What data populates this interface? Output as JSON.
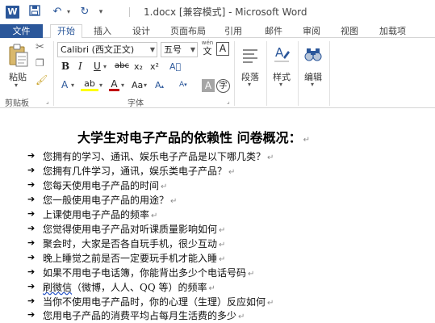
{
  "titlebar": {
    "title": "1.docx [兼容模式] - Microsoft Word",
    "app_icon_letter": "W",
    "qat": {
      "save_icon": "save-icon",
      "undo_icon": "undo-icon",
      "redo_icon": "redo-icon",
      "customize_icon": "customize-qat-icon"
    }
  },
  "tabs": {
    "file": "文件",
    "items": [
      "开始",
      "插入",
      "设计",
      "页面布局",
      "引用",
      "邮件",
      "审阅",
      "视图",
      "加载项"
    ],
    "active": "开始"
  },
  "ribbon": {
    "clipboard": {
      "paste_label": "粘贴",
      "group_label": "剪贴板"
    },
    "font": {
      "font_name": "Calibri (西文正文)",
      "font_size": "五号",
      "wen_label": "wén",
      "wen_char": "文",
      "bold": "B",
      "italic": "I",
      "underline": "U",
      "strike": "abc",
      "subscript": "x₂",
      "superscript": "x²",
      "grow_font": "A",
      "shrink_font": "A",
      "case_label": "Aa",
      "clear_format_label": "A",
      "highlight_label": "ab",
      "font_color_label": "A",
      "char_shade_label": "A",
      "enclose_char_label": "字",
      "group_label": "字体"
    },
    "paragraph": {
      "label": "段落"
    },
    "styles": {
      "label": "样式"
    },
    "editing": {
      "label": "编辑"
    },
    "colors": {
      "accent": "#2b579a",
      "font_color": "#c00000",
      "highlight": "#ffff00"
    }
  },
  "document": {
    "heading": "大学生对电子产品的依赖性  问卷概况：",
    "bullet_glyph": "➔",
    "paragraph_mark": "↵",
    "items": [
      "您拥有的学习、通讯、娱乐电子产品是以下哪几类？",
      "您拥有几件学习，通讯，娱乐类电子产品？",
      "您每天使用电子产品的时间",
      "您一般使用电子产品的用途？",
      "上课使用电子产品的频率",
      "您觉得使用电子产品对听课质量影响如何",
      "聚会时，大家是否各自玩手机，很少互动",
      "晚上睡觉之前是否一定要玩手机才能入睡",
      "如果不用电子电话簿，你能背出多少个电话号码",
      "（微博，人人、QQ 等）的频率",
      "当你不使用电子产品时，你的心理（生理）反应如何",
      "您用电子产品的消费平均占每月生活费的多少"
    ],
    "item_10_prefix": "刷微信"
  }
}
